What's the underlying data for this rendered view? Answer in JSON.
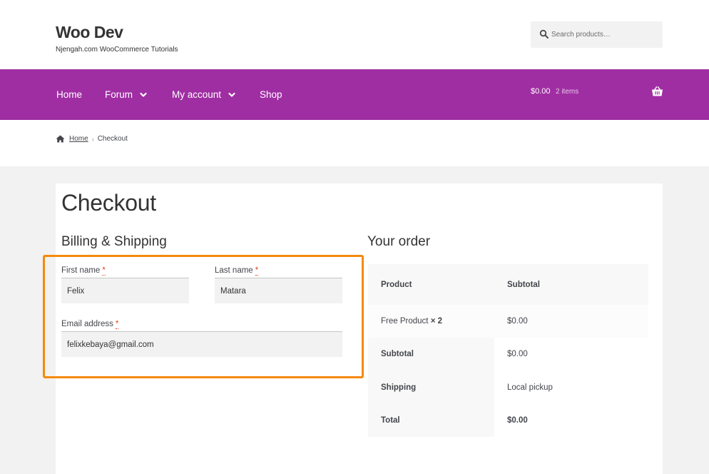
{
  "header": {
    "site_title": "Woo Dev",
    "site_description": "Njengah.com WooCommerce Tutorials",
    "search_placeholder": "Search products…"
  },
  "nav": {
    "items": [
      {
        "label": "Home",
        "has_dropdown": false
      },
      {
        "label": "Forum",
        "has_dropdown": true
      },
      {
        "label": "My account",
        "has_dropdown": true
      },
      {
        "label": "Shop",
        "has_dropdown": false
      }
    ],
    "cart_amount": "$0.00",
    "cart_count": "2 items",
    "nav_color": "#a02ea3"
  },
  "breadcrumb": {
    "home": "Home",
    "current": "Checkout"
  },
  "page": {
    "title": "Checkout",
    "billing_heading": "Billing & Shipping",
    "order_heading": "Your order"
  },
  "form": {
    "first_name_label": "First name",
    "first_name_value": "Felix",
    "last_name_label": "Last name",
    "last_name_value": "Matara",
    "email_label": "Email address",
    "email_value": "felixkebaya@gmail.com",
    "required_marker": "*",
    "highlight_color": "#f58a0c"
  },
  "order": {
    "col_product": "Product",
    "col_subtotal": "Subtotal",
    "item_name": "Free Product",
    "item_qty": "× 2",
    "item_subtotal": "$0.00",
    "subtotal_label": "Subtotal",
    "subtotal_value": "$0.00",
    "shipping_label": "Shipping",
    "shipping_value": "Local pickup",
    "total_label": "Total",
    "total_value": "$0.00"
  }
}
